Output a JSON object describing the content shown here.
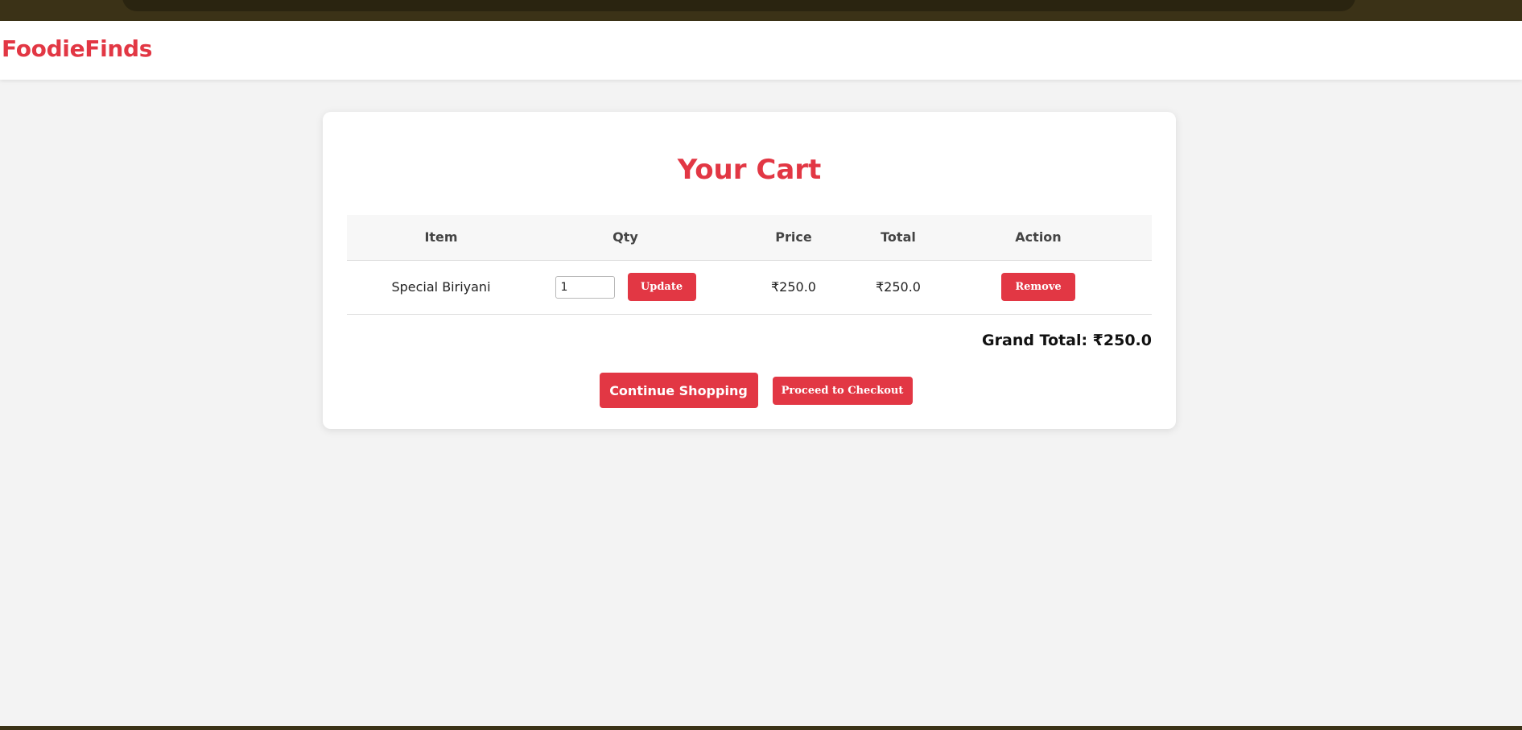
{
  "brand": {
    "name": "FoodieFinds"
  },
  "cart": {
    "title": "Your Cart",
    "columns": [
      "Item",
      "Qty",
      "Price",
      "Total",
      "Action"
    ],
    "rows": [
      {
        "item": "Special Biriyani",
        "qty": "1",
        "update_label": "Update",
        "price": "₹250.0",
        "total": "₹250.0",
        "remove_label": "Remove"
      }
    ],
    "grand_total": "Grand Total: ₹250.0",
    "continue_label": "Continue Shopping",
    "checkout_label": "Proceed to Checkout"
  },
  "colors": {
    "accent": "#e23744",
    "background": "#f3f3f3",
    "card": "#ffffff"
  }
}
